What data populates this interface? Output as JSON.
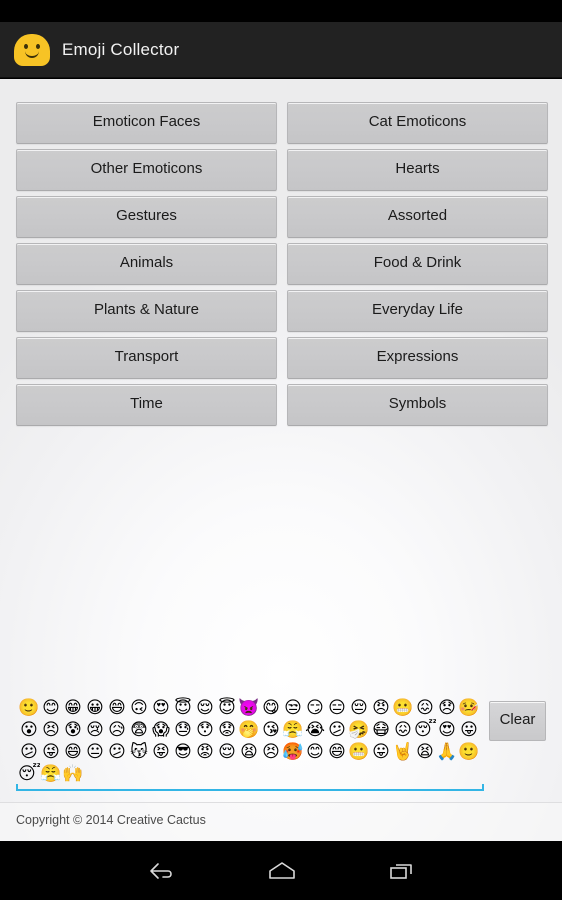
{
  "app": {
    "title": "Emoji Collector",
    "icon": "smiley-face-icon"
  },
  "status_bar": {
    "background": "#000000"
  },
  "theme": {
    "accent": "#33b5e5",
    "action_bar_bg": "#222222",
    "button_bg": "#c9c9cb",
    "icon_yellow": "#f7c325"
  },
  "categories": [
    {
      "label": "Emoticon Faces",
      "column": "left"
    },
    {
      "label": "Cat Emoticons",
      "column": "right"
    },
    {
      "label": "Other Emoticons",
      "column": "left"
    },
    {
      "label": "Hearts",
      "column": "right"
    },
    {
      "label": "Gestures",
      "column": "left"
    },
    {
      "label": "Assorted",
      "column": "right"
    },
    {
      "label": "Animals",
      "column": "left"
    },
    {
      "label": "Food & Drink",
      "column": "right"
    },
    {
      "label": "Plants & Nature",
      "column": "left"
    },
    {
      "label": "Everyday Life",
      "column": "right"
    },
    {
      "label": "Transport",
      "column": "left"
    },
    {
      "label": "Expressions",
      "column": "right"
    },
    {
      "label": "Time",
      "column": "left"
    },
    {
      "label": "Symbols",
      "column": "right"
    }
  ],
  "collection": {
    "clear_label": "Clear",
    "emoji_count": 65,
    "emojis": [
      "🙂",
      "😊",
      "😁",
      "😀",
      "😄",
      "🙃",
      "😍",
      "😇",
      "😌",
      "😇",
      "👿",
      "😋",
      "😒",
      "😏",
      "😑",
      "😔",
      "😠",
      "😬",
      "😖",
      "😞",
      "🤒",
      "😮",
      "😣",
      "😰",
      "😢",
      "😥",
      "😨",
      "😱",
      "😓",
      "😯",
      "😟",
      "🤭",
      "😘",
      "😤",
      "😭",
      "😕",
      "🤧",
      "😷",
      "😖",
      "😴",
      "😍",
      "😛",
      "😕",
      "😜",
      "😄",
      "😐",
      "😕",
      "😽",
      "😝",
      "😎",
      "😡",
      "😌",
      "😫",
      "😣",
      "🥵",
      "😊",
      "😄",
      "😬",
      "😛",
      "🤘",
      "😫",
      "🙏",
      "🙂",
      "😴",
      "😤",
      "🙌"
    ]
  },
  "footer": {
    "copyright": "Copyright © 2014 Creative Cactus"
  },
  "nav_bar": {
    "back": "back-icon",
    "home": "home-icon",
    "recent": "recent-apps-icon"
  }
}
